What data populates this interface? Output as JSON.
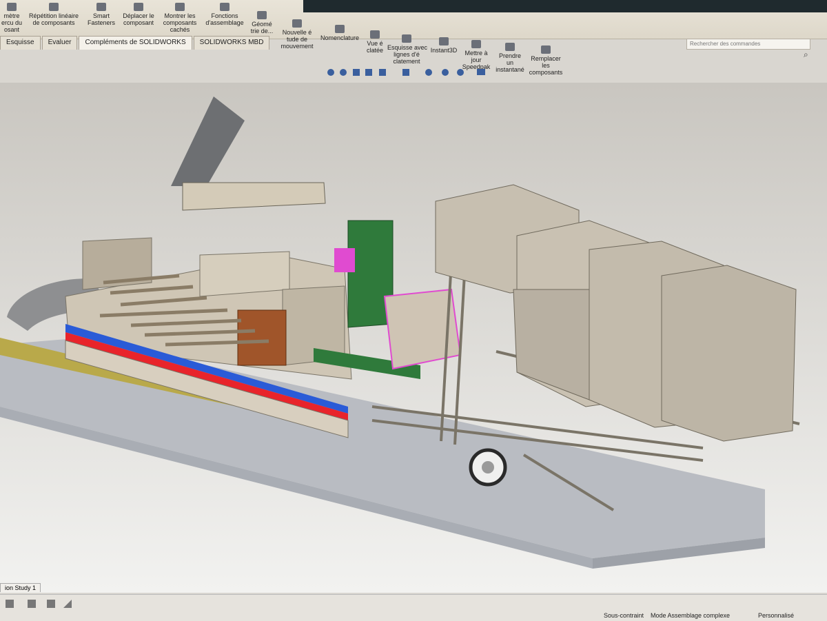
{
  "ribbon": {
    "items": [
      "mètre\nercu du\nosant",
      "Répétition linéaire\nde composants",
      "Smart\nFasteners",
      "Déplacer le\ncomposant",
      "Montrer les\ncomposants\ncachés",
      "Fonctions\nd'assemblage",
      "Géomé\ntrie de...",
      "Nouvelle é\ntude de\nmouvement",
      "Nomenclature",
      "Vue é\nclatée",
      "Esquisse avec\nlignes d'é\nclatement",
      "Instant3D",
      "Mettre à\njour\nSpeedpak",
      "Prendre\nun\ninstantané",
      "Remplacer\nles\ncomposants"
    ]
  },
  "tabs": [
    "Esquisse",
    "Evaluer",
    "Compléments de SOLIDWORKS",
    "SOLIDWORKS MBD"
  ],
  "search": {
    "placeholder": "Rechercher des commandes"
  },
  "study_tab": "ion Study 1",
  "status": {
    "left": "Sous-contraint",
    "mode": "Mode Assemblage complexe",
    "custom": "Personnalisé"
  },
  "colors": {
    "ribbon_bg": "#e4dfd2",
    "model_beige": "#c9c0b1",
    "blue_rail": "#2a5bd7",
    "red_rail": "#e8242b",
    "floor": "#b9bcc2",
    "pink_highlight": "#e04bd0",
    "green_conveyor": "#2f7a3b"
  }
}
